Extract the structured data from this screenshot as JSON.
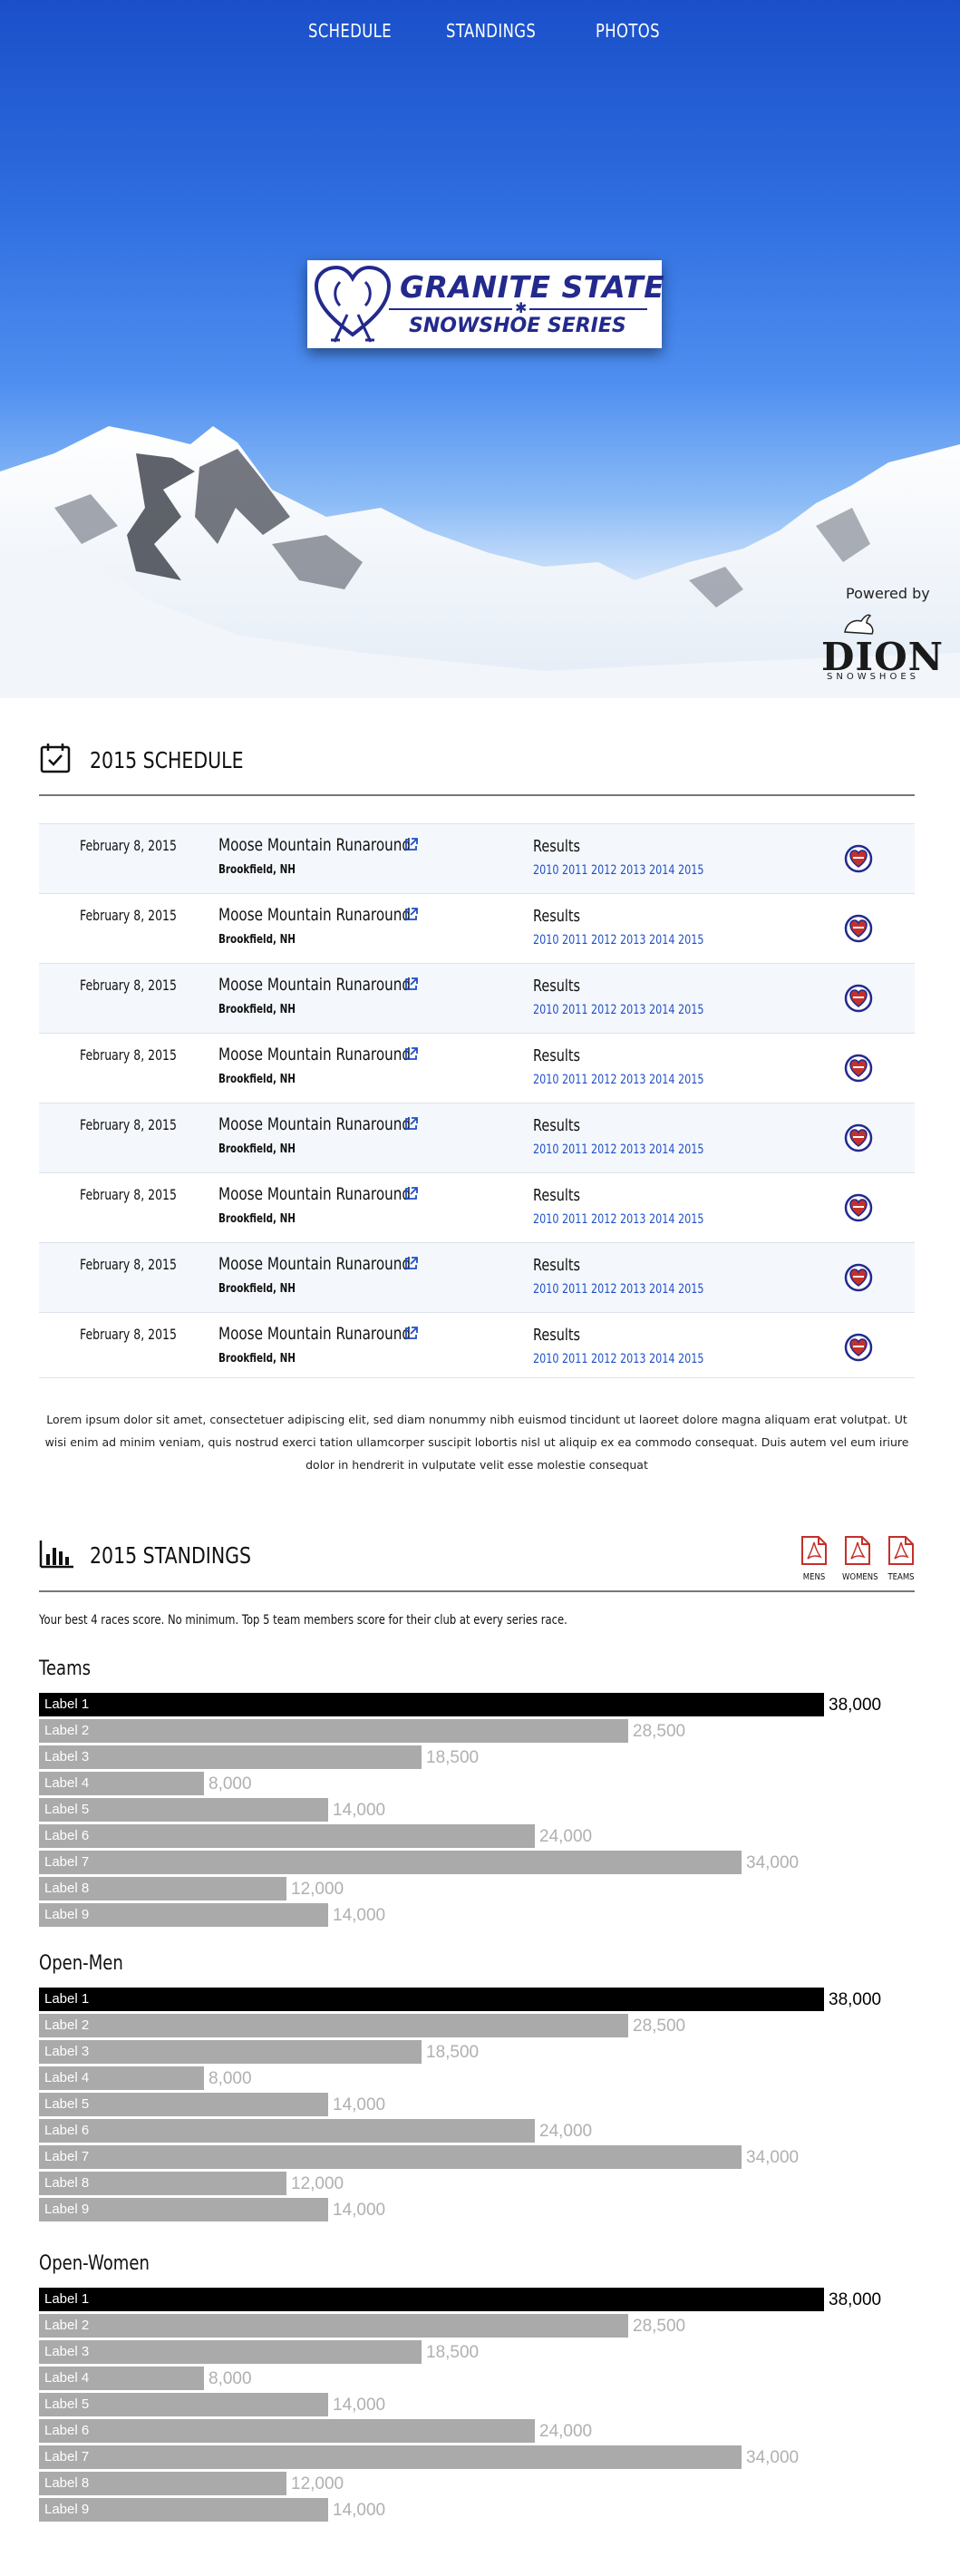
{
  "nav": {
    "items": [
      "SCHEDULE",
      "STANDINGS",
      "PHOTOS"
    ]
  },
  "logo": {
    "line1": "GRANITE STATE",
    "line2": "SNOWSHOE SERIES"
  },
  "sponsor": {
    "powered": "Powered by",
    "name": "DION",
    "sub": "SNOWSHOES"
  },
  "schedule": {
    "title": "2015 SCHEDULE",
    "rows": [
      {
        "date": "February 8, 2015",
        "event": "Moose Mountain Runaround",
        "location": "Brookfield, NH",
        "results_label": "Results",
        "years": [
          "2010",
          "2011",
          "2012",
          "2013",
          "2014",
          "2015"
        ]
      },
      {
        "date": "February 8, 2015",
        "event": "Moose Mountain Runaround",
        "location": "Brookfield, NH",
        "results_label": "Results",
        "years": [
          "2010",
          "2011",
          "2012",
          "2013",
          "2014",
          "2015"
        ]
      },
      {
        "date": "February 8, 2015",
        "event": "Moose Mountain Runaround",
        "location": "Brookfield, NH",
        "results_label": "Results",
        "years": [
          "2010",
          "2011",
          "2012",
          "2013",
          "2014",
          "2015"
        ]
      },
      {
        "date": "February 8, 2015",
        "event": "Moose Mountain Runaround",
        "location": "Brookfield, NH",
        "results_label": "Results",
        "years": [
          "2010",
          "2011",
          "2012",
          "2013",
          "2014",
          "2015"
        ]
      },
      {
        "date": "February 8, 2015",
        "event": "Moose Mountain Runaround",
        "location": "Brookfield, NH",
        "results_label": "Results",
        "years": [
          "2010",
          "2011",
          "2012",
          "2013",
          "2014",
          "2015"
        ]
      },
      {
        "date": "February 8, 2015",
        "event": "Moose Mountain Runaround",
        "location": "Brookfield, NH",
        "results_label": "Results",
        "years": [
          "2010",
          "2011",
          "2012",
          "2013",
          "2014",
          "2015"
        ]
      },
      {
        "date": "February 8, 2015",
        "event": "Moose Mountain Runaround",
        "location": "Brookfield, NH",
        "results_label": "Results",
        "years": [
          "2010",
          "2011",
          "2012",
          "2013",
          "2014",
          "2015"
        ]
      },
      {
        "date": "February 8, 2015",
        "event": "Moose Mountain Runaround",
        "location": "Brookfield, NH",
        "results_label": "Results",
        "years": [
          "2010",
          "2011",
          "2012",
          "2013",
          "2014",
          "2015"
        ]
      }
    ],
    "lorem": "Lorem ipsum dolor sit amet, consectetuer adipiscing elit, sed diam nonummy nibh euismod tincidunt ut laoreet dolore magna aliquam erat volutpat. Ut wisi enim ad minim veniam, quis nostrud exerci tation ullamcorper suscipit lobortis nisl ut aliquip ex ea commodo consequat. Duis autem vel eum iriure dolor in hendrerit in vulputate velit esse molestie consequat"
  },
  "standings": {
    "title": "2015 STANDINGS",
    "downloads": [
      "MENS",
      "WOMENS",
      "TEAMS"
    ],
    "note": "Your best 4 races score.  No minimum.  Top 5 team members score for their club at every series race.",
    "colors": {
      "top_bar": "#000000",
      "bar": "#aaaaaa"
    }
  },
  "chart_data": [
    {
      "type": "bar",
      "title": "Teams",
      "categories": [
        "Label 1",
        "Label 2",
        "Label 3",
        "Label 4",
        "Label 5",
        "Label 6",
        "Label 7",
        "Label 8",
        "Label 9"
      ],
      "values": [
        38000,
        28500,
        18500,
        8000,
        14000,
        24000,
        34000,
        12000,
        14000
      ],
      "value_labels": [
        "38,000",
        "28,500",
        "18,500",
        "8,000",
        "14,000",
        "24,000",
        "34,000",
        "12,000",
        "14,000"
      ],
      "xlim": [
        0,
        38000
      ]
    },
    {
      "type": "bar",
      "title": "Open-Men",
      "categories": [
        "Label 1",
        "Label 2",
        "Label 3",
        "Label 4",
        "Label 5",
        "Label 6",
        "Label 7",
        "Label 8",
        "Label 9"
      ],
      "values": [
        38000,
        28500,
        18500,
        8000,
        14000,
        24000,
        34000,
        12000,
        14000
      ],
      "value_labels": [
        "38,000",
        "28,500",
        "18,500",
        "8,000",
        "14,000",
        "24,000",
        "34,000",
        "12,000",
        "14,000"
      ],
      "xlim": [
        0,
        38000
      ]
    },
    {
      "type": "bar",
      "title": "Open-Women",
      "categories": [
        "Label 1",
        "Label 2",
        "Label 3",
        "Label 4",
        "Label 5",
        "Label 6",
        "Label 7",
        "Label 8",
        "Label 9"
      ],
      "values": [
        38000,
        28500,
        18500,
        8000,
        14000,
        24000,
        34000,
        12000,
        14000
      ],
      "value_labels": [
        "38,000",
        "28,500",
        "18,500",
        "8,000",
        "14,000",
        "24,000",
        "34,000",
        "12,000",
        "14,000"
      ],
      "xlim": [
        0,
        38000
      ]
    }
  ]
}
